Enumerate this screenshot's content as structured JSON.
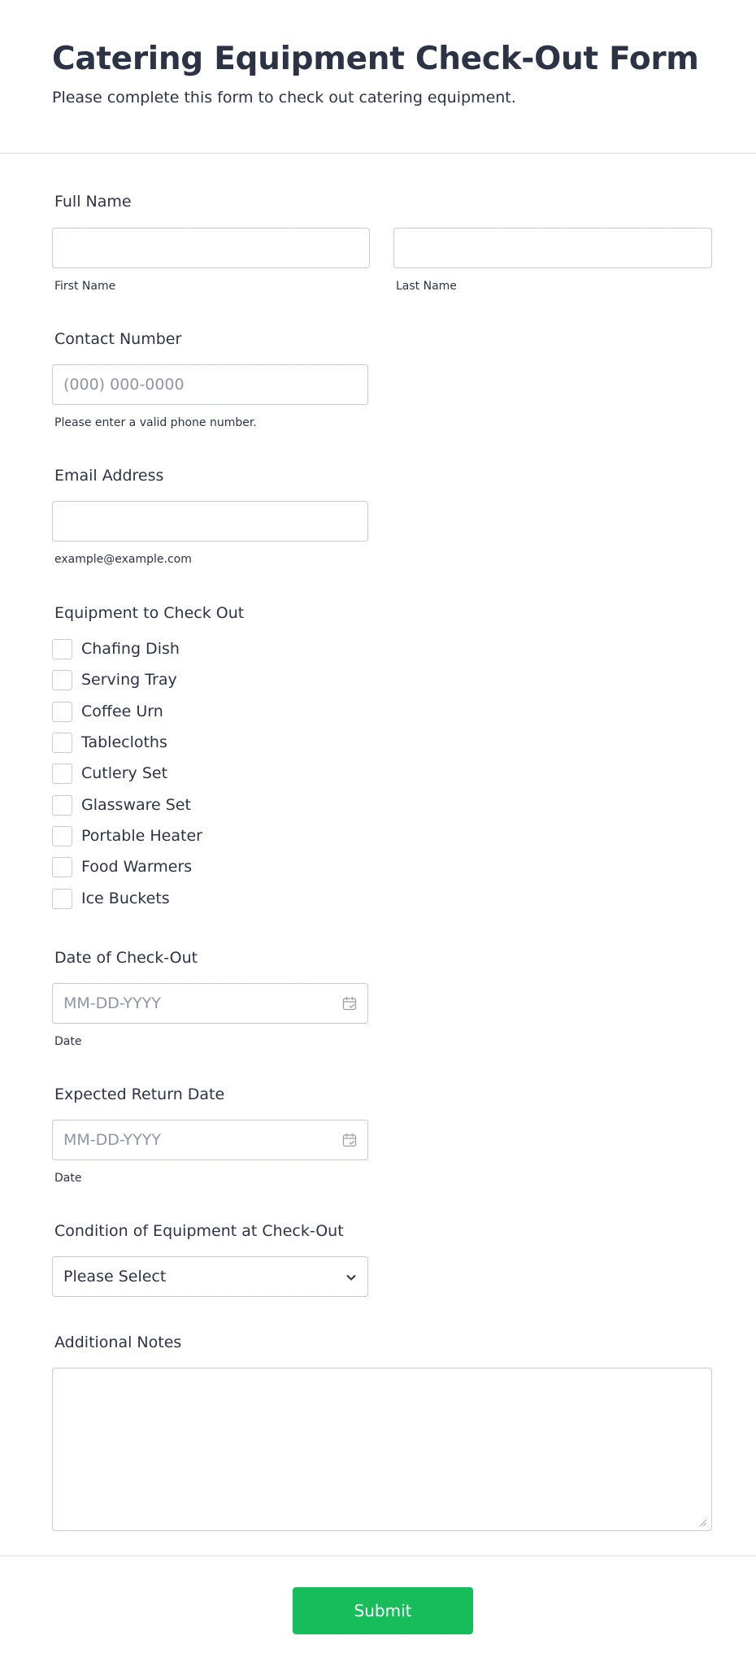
{
  "header": {
    "title": "Catering Equipment Check-Out Form",
    "subtitle": "Please complete this form to check out catering equipment."
  },
  "full_name": {
    "label": "Full Name",
    "first_value": "",
    "last_value": "",
    "first_sublabel": "First Name",
    "last_sublabel": "Last Name"
  },
  "contact": {
    "label": "Contact Number",
    "placeholder": "(000) 000-0000",
    "value": "",
    "hint": "Please enter a valid phone number."
  },
  "email": {
    "label": "Email Address",
    "value": "",
    "hint": "example@example.com"
  },
  "equipment": {
    "label": "Equipment to Check Out",
    "options": [
      {
        "label": "Chafing Dish",
        "checked": false
      },
      {
        "label": "Serving Tray",
        "checked": false
      },
      {
        "label": "Coffee Urn",
        "checked": false
      },
      {
        "label": "Tablecloths",
        "checked": false
      },
      {
        "label": "Cutlery Set",
        "checked": false
      },
      {
        "label": "Glassware Set",
        "checked": false
      },
      {
        "label": "Portable Heater",
        "checked": false
      },
      {
        "label": "Food Warmers",
        "checked": false
      },
      {
        "label": "Ice Buckets",
        "checked": false
      }
    ]
  },
  "checkout_date": {
    "label": "Date of Check-Out",
    "placeholder": "MM-DD-YYYY",
    "sublabel": "Date",
    "icon": "calendar-icon"
  },
  "return_date": {
    "label": "Expected Return Date",
    "placeholder": "MM-DD-YYYY",
    "sublabel": "Date",
    "icon": "calendar-icon"
  },
  "condition": {
    "label": "Condition of Equipment at Check-Out",
    "selected": "Please Select",
    "icon": "chevron-down-icon"
  },
  "notes": {
    "label": "Additional Notes",
    "value": ""
  },
  "submit": {
    "label": "Submit",
    "color": "#18bd5b"
  },
  "colors": {
    "text": "#2c3345",
    "border": "#c3cad8",
    "placeholder": "#8f96a3",
    "divider": "#dadde3"
  }
}
